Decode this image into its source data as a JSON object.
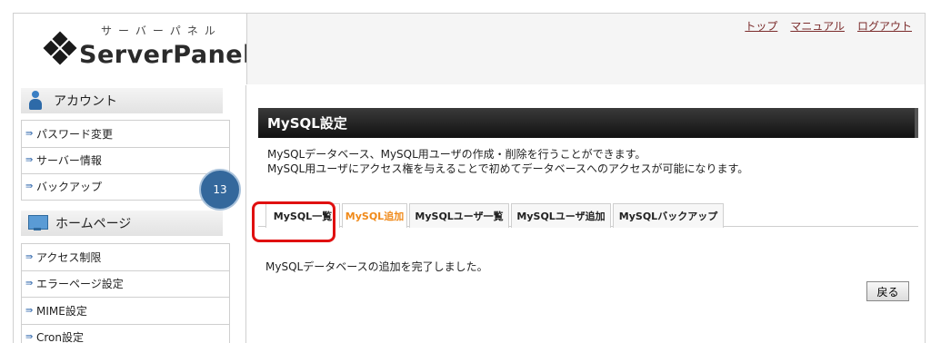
{
  "header": {
    "logo_kana": "サーバーパネル",
    "logo_name": "ServerPanel",
    "links": [
      "トップ",
      "マニュアル",
      "ログアウト"
    ]
  },
  "sidebar": {
    "sections": [
      {
        "title": "アカウント",
        "icon": "person-icon",
        "items": [
          "パスワード変更",
          "サーバー情報",
          "バックアップ"
        ]
      },
      {
        "title": "ホームページ",
        "icon": "monitor-icon",
        "items": [
          "アクセス制限",
          "エラーページ設定",
          "MIME設定",
          "Cron設定"
        ]
      }
    ]
  },
  "main": {
    "title": "MySQL設定",
    "description_line1": "MySQLデータベース、MySQL用ユーザの作成・削除を行うことができます。",
    "description_line2": "MySQL用ユーザにアクセス権を与えることで初めてデータベースへのアクセスが可能になります。",
    "tabs": [
      {
        "label": "MySQL一覧",
        "active": false
      },
      {
        "label": "MySQL追加",
        "active": true
      },
      {
        "label": "MySQLユーザ一覧",
        "active": false
      },
      {
        "label": "MySQLユーザ追加",
        "active": false
      },
      {
        "label": "MySQLバックアップ",
        "active": false
      }
    ],
    "message": "MySQLデータベースの追加を完了しました。",
    "back_label": "戻る"
  },
  "annotation": {
    "step_number": "13",
    "highlight_color": "#e01010"
  },
  "colors": {
    "active_tab": "#f08a1a",
    "title_bar": "#111111",
    "link": "#7b2c2c"
  }
}
